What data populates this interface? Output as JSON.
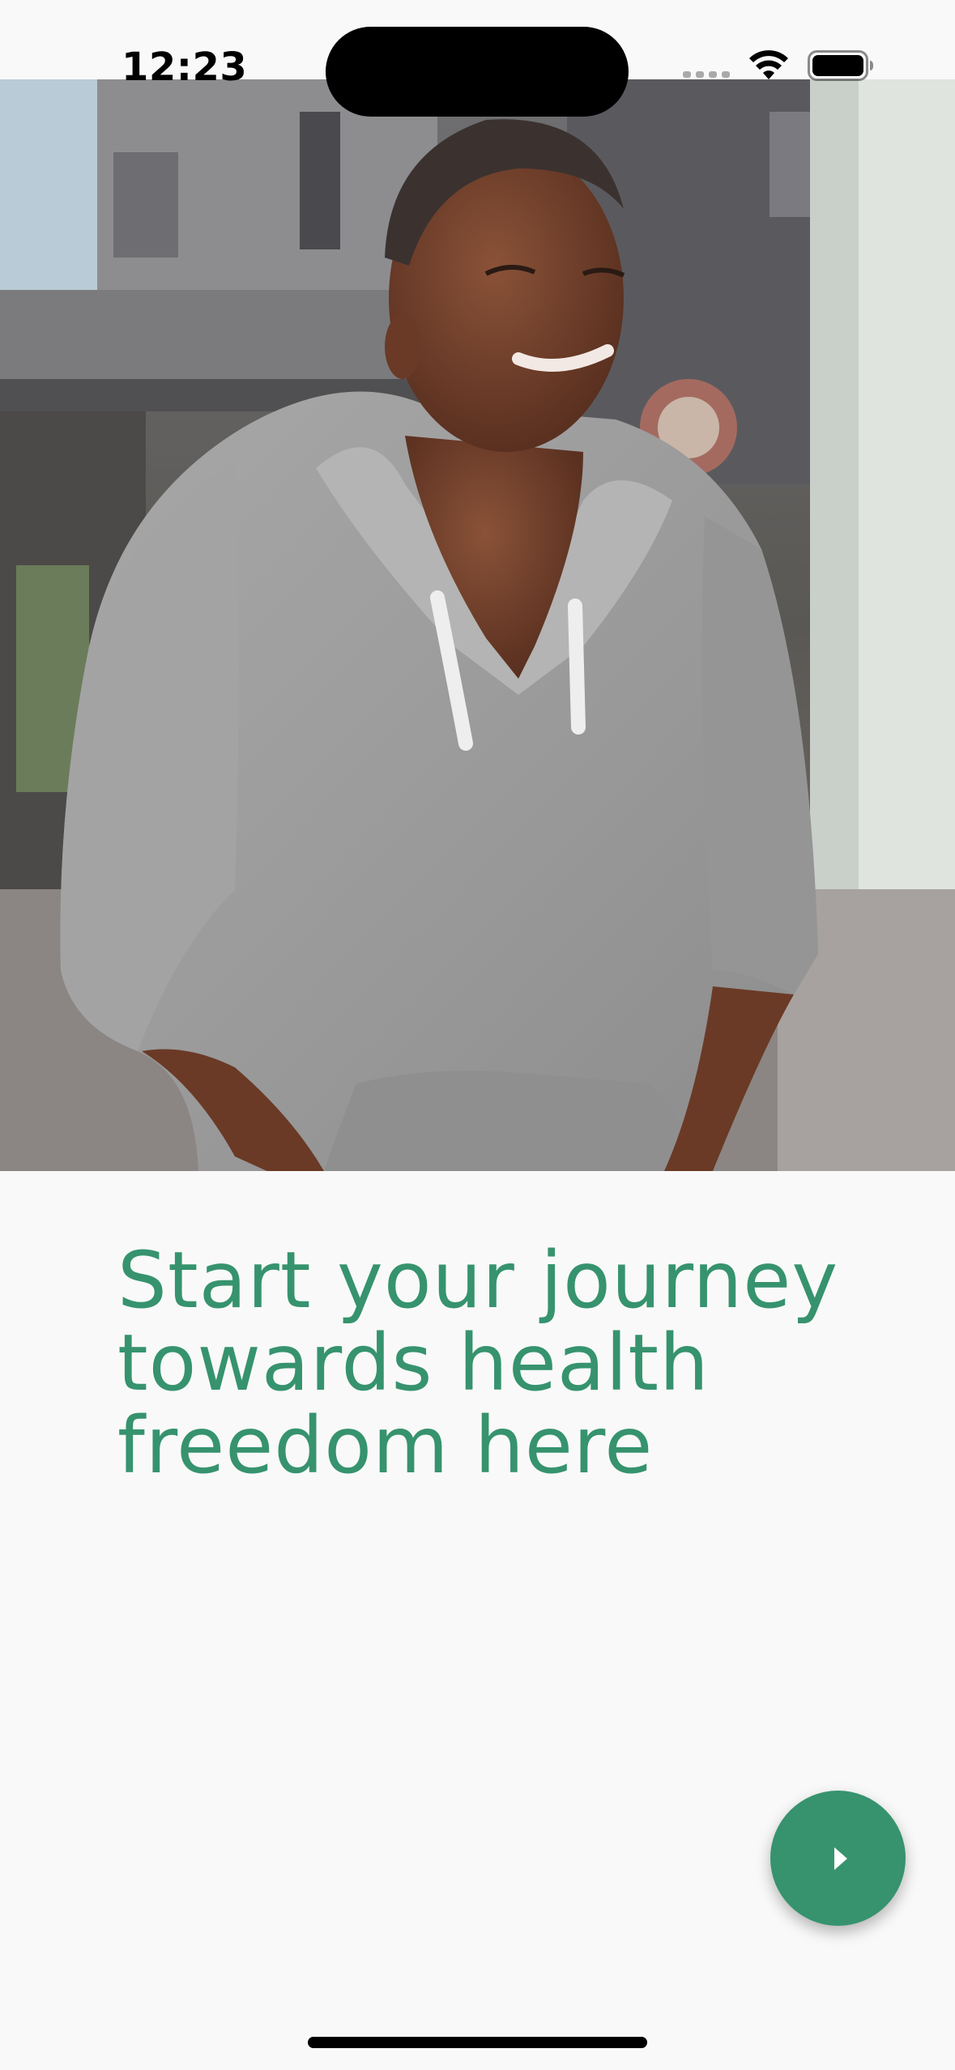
{
  "status_bar": {
    "time": "12:23",
    "icons": [
      "cellular-signal-icon",
      "wifi-icon",
      "battery-icon"
    ]
  },
  "hero": {
    "image": "photo-smiling-woman-grey-hoodie"
  },
  "content": {
    "headline": "Start your journey towards health freedom here"
  },
  "fab": {
    "icon": "play-arrow-icon"
  },
  "colors": {
    "accent": "#36936e",
    "background": "#f9f9f9"
  }
}
